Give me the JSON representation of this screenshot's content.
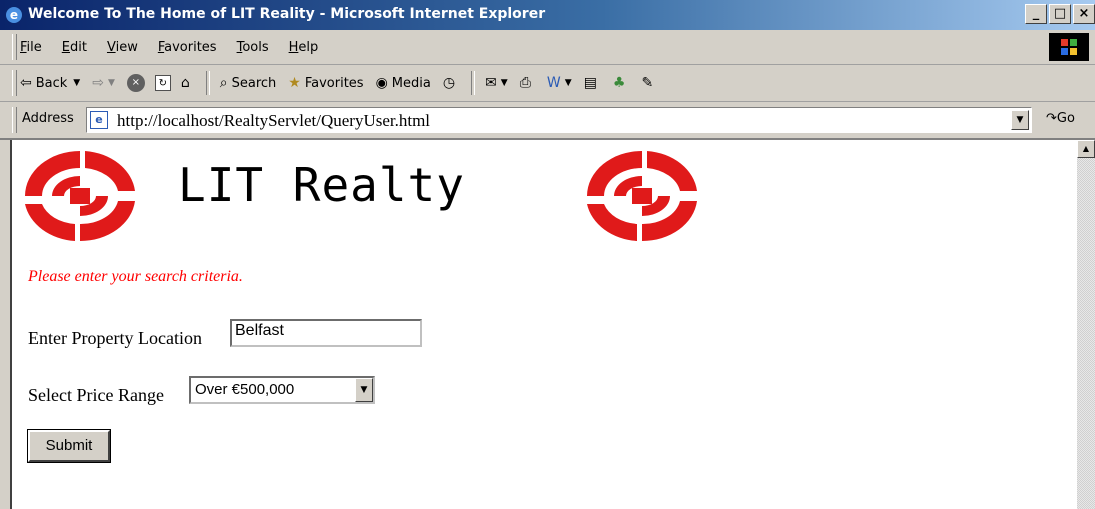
{
  "window": {
    "title": "Welcome To The Home of LIT Reality - Microsoft Internet Explorer"
  },
  "window_buttons": [
    "_",
    "□",
    "×"
  ],
  "menu": [
    "File",
    "Edit",
    "View",
    "Favorites",
    "Tools",
    "Help"
  ],
  "toolbar": {
    "back": "Back",
    "search": "Search",
    "favorites": "Favorites",
    "media": "Media"
  },
  "address": {
    "label": "Address",
    "url": "http://localhost/RealtyServlet/QueryUser.html",
    "go": "Go"
  },
  "page": {
    "logo_text": "LIT Realty",
    "prompt": "Please enter your search criteria.",
    "location_label": "Enter Property Location",
    "location_value": "Belfast",
    "price_label": "Select Price Range",
    "price_value": "Over €500,000",
    "submit": "Submit"
  },
  "colors": {
    "logo_red": "#e01a1a",
    "prompt_red": "#ff0000",
    "titlebar": "#0a246a"
  },
  "icons": [
    "ie-icon",
    "back-arrow-icon",
    "forward-arrow-icon",
    "stop-icon",
    "refresh-icon",
    "home-icon",
    "search-icon",
    "favorites-icon",
    "media-icon",
    "history-icon",
    "mail-icon",
    "print-icon",
    "edit-icon",
    "discuss-icon",
    "messenger-icon",
    "page-icon",
    "go-icon"
  ]
}
